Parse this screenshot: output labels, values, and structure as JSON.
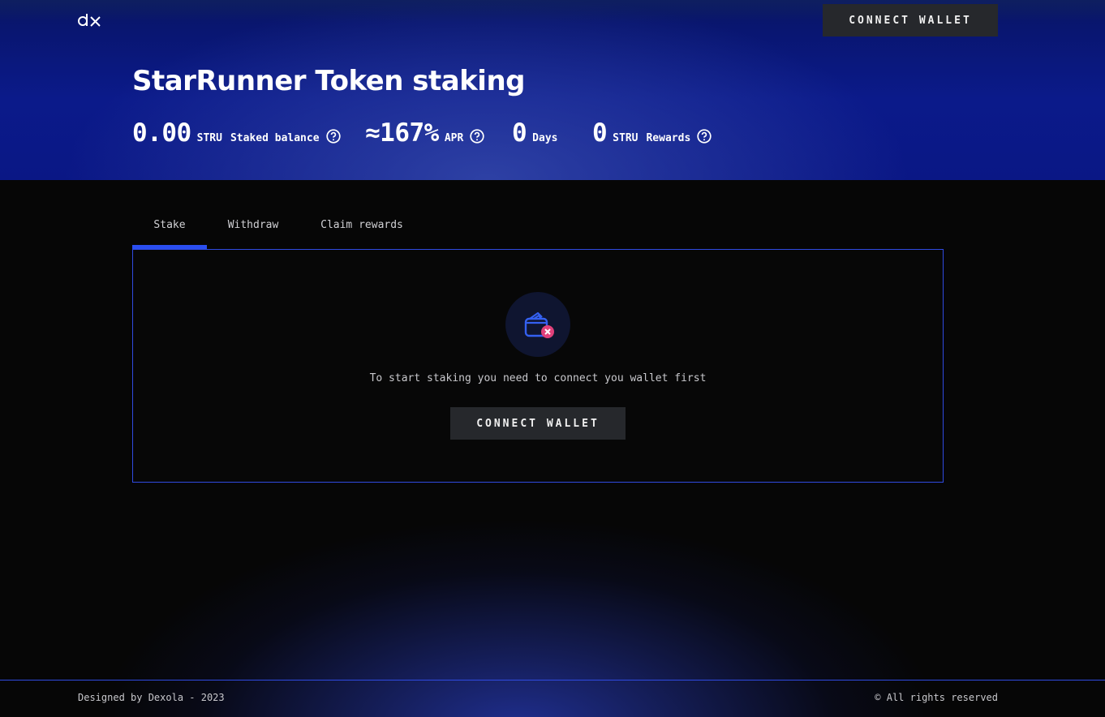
{
  "header": {
    "logo_text": "dx",
    "connect_label": "CONNECT WALLET"
  },
  "hero": {
    "title": "StarRunner Token staking",
    "stats": [
      {
        "value": "0.00",
        "unit": "STRU",
        "label": "Staked balance",
        "help": true
      },
      {
        "value": "≈167%",
        "unit": "APR",
        "label": "",
        "help": true
      },
      {
        "value": "0",
        "unit": "Days",
        "label": "",
        "help": false
      },
      {
        "value": "0",
        "unit": "STRU",
        "label": "Rewards",
        "help": true
      }
    ]
  },
  "tabs": [
    {
      "label": "Stake",
      "active": true
    },
    {
      "label": "Withdraw",
      "active": false
    },
    {
      "label": "Claim rewards",
      "active": false
    }
  ],
  "panel": {
    "icon": "wallet-disconnected-icon",
    "message": "To start staking you need to connect you wallet first",
    "connect_label": "CONNECT WALLET"
  },
  "footer": {
    "left": "Designed by Dexola - 2023",
    "right": "© All rights reserved"
  },
  "colors": {
    "accent": "#2a4ef0",
    "hero_bg": "#0b1a8a",
    "button_bg": "#26282c",
    "error_badge": "#e0407a"
  }
}
